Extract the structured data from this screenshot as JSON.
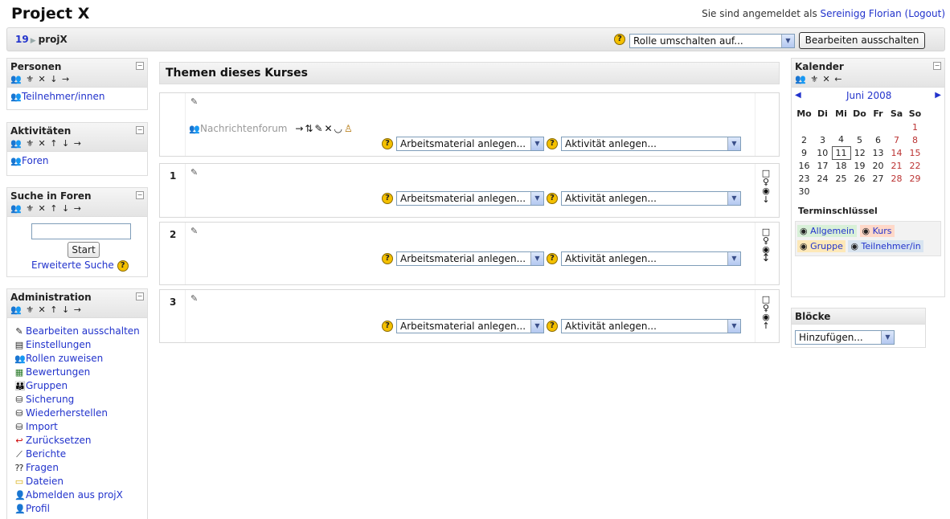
{
  "header": {
    "site_title": "Project X",
    "login_prefix": "Sie sind angemeldet als",
    "user_name": "Sereinigg Florian",
    "logout": "(Logout)"
  },
  "breadcrumb": {
    "home": "19",
    "course": "projX"
  },
  "role_switch": {
    "selected": "Rolle umschalten auf...",
    "button": "Bearbeiten ausschalten"
  },
  "blocks": {
    "people": {
      "title": "Personen",
      "controls": "⚜ ✕ ↓ →",
      "items": [
        "Teilnehmer/innen"
      ]
    },
    "activities": {
      "title": "Aktivitäten",
      "controls": "⚜ ✕ ↑ ↓ →",
      "items": [
        "Foren"
      ]
    },
    "search": {
      "title": "Suche in Foren",
      "controls": "⚜ ✕ ↑ ↓ →",
      "button": "Start",
      "advanced": "Erweiterte Suche"
    },
    "admin": {
      "title": "Administration",
      "controls": "⚜ ✕ ↑ ↓ →",
      "items": [
        "Bearbeiten ausschalten",
        "Einstellungen",
        "Rollen zuweisen",
        "Bewertungen",
        "Gruppen",
        "Sicherung",
        "Wiederherstellen",
        "Import",
        "Zurücksetzen",
        "Berichte",
        "Fragen",
        "Dateien",
        "Abmelden aus projX",
        "Profil"
      ]
    },
    "calendar": {
      "title": "Kalender",
      "controls": "⚜ ✕ ←",
      "month": "Juni 2008",
      "weekdays": [
        "Mo",
        "Di",
        "Mi",
        "Do",
        "Fr",
        "Sa",
        "So"
      ],
      "weeks": [
        [
          "",
          "",
          "",
          "",
          "",
          "",
          "1"
        ],
        [
          "2",
          "3",
          "4",
          "5",
          "6",
          "7",
          "8"
        ],
        [
          "9",
          "10",
          "11",
          "12",
          "13",
          "14",
          "15"
        ],
        [
          "16",
          "17",
          "18",
          "19",
          "20",
          "21",
          "22"
        ],
        [
          "23",
          "24",
          "25",
          "26",
          "27",
          "28",
          "29"
        ],
        [
          "30",
          "",
          "",
          "",
          "",
          "",
          ""
        ]
      ],
      "today": "11",
      "legend_title": "Terminschlüssel",
      "legend": [
        "Allgemein",
        "Kurs",
        "Gruppe",
        "Teilnehmer/in"
      ]
    },
    "blocks": {
      "title": "Blöcke",
      "selected": "Hinzufügen..."
    }
  },
  "main": {
    "title": "Themen dieses Kurses",
    "forum": "Nachrichtenforum",
    "resource_select": "Arbeitsmaterial anlegen...",
    "activity_select": "Aktivität anlegen...",
    "sections": [
      "1",
      "2",
      "3"
    ]
  },
  "colors": {
    "link": "#2233cc",
    "weekend": "#b33333",
    "header_bg": "#e4e4e4"
  }
}
